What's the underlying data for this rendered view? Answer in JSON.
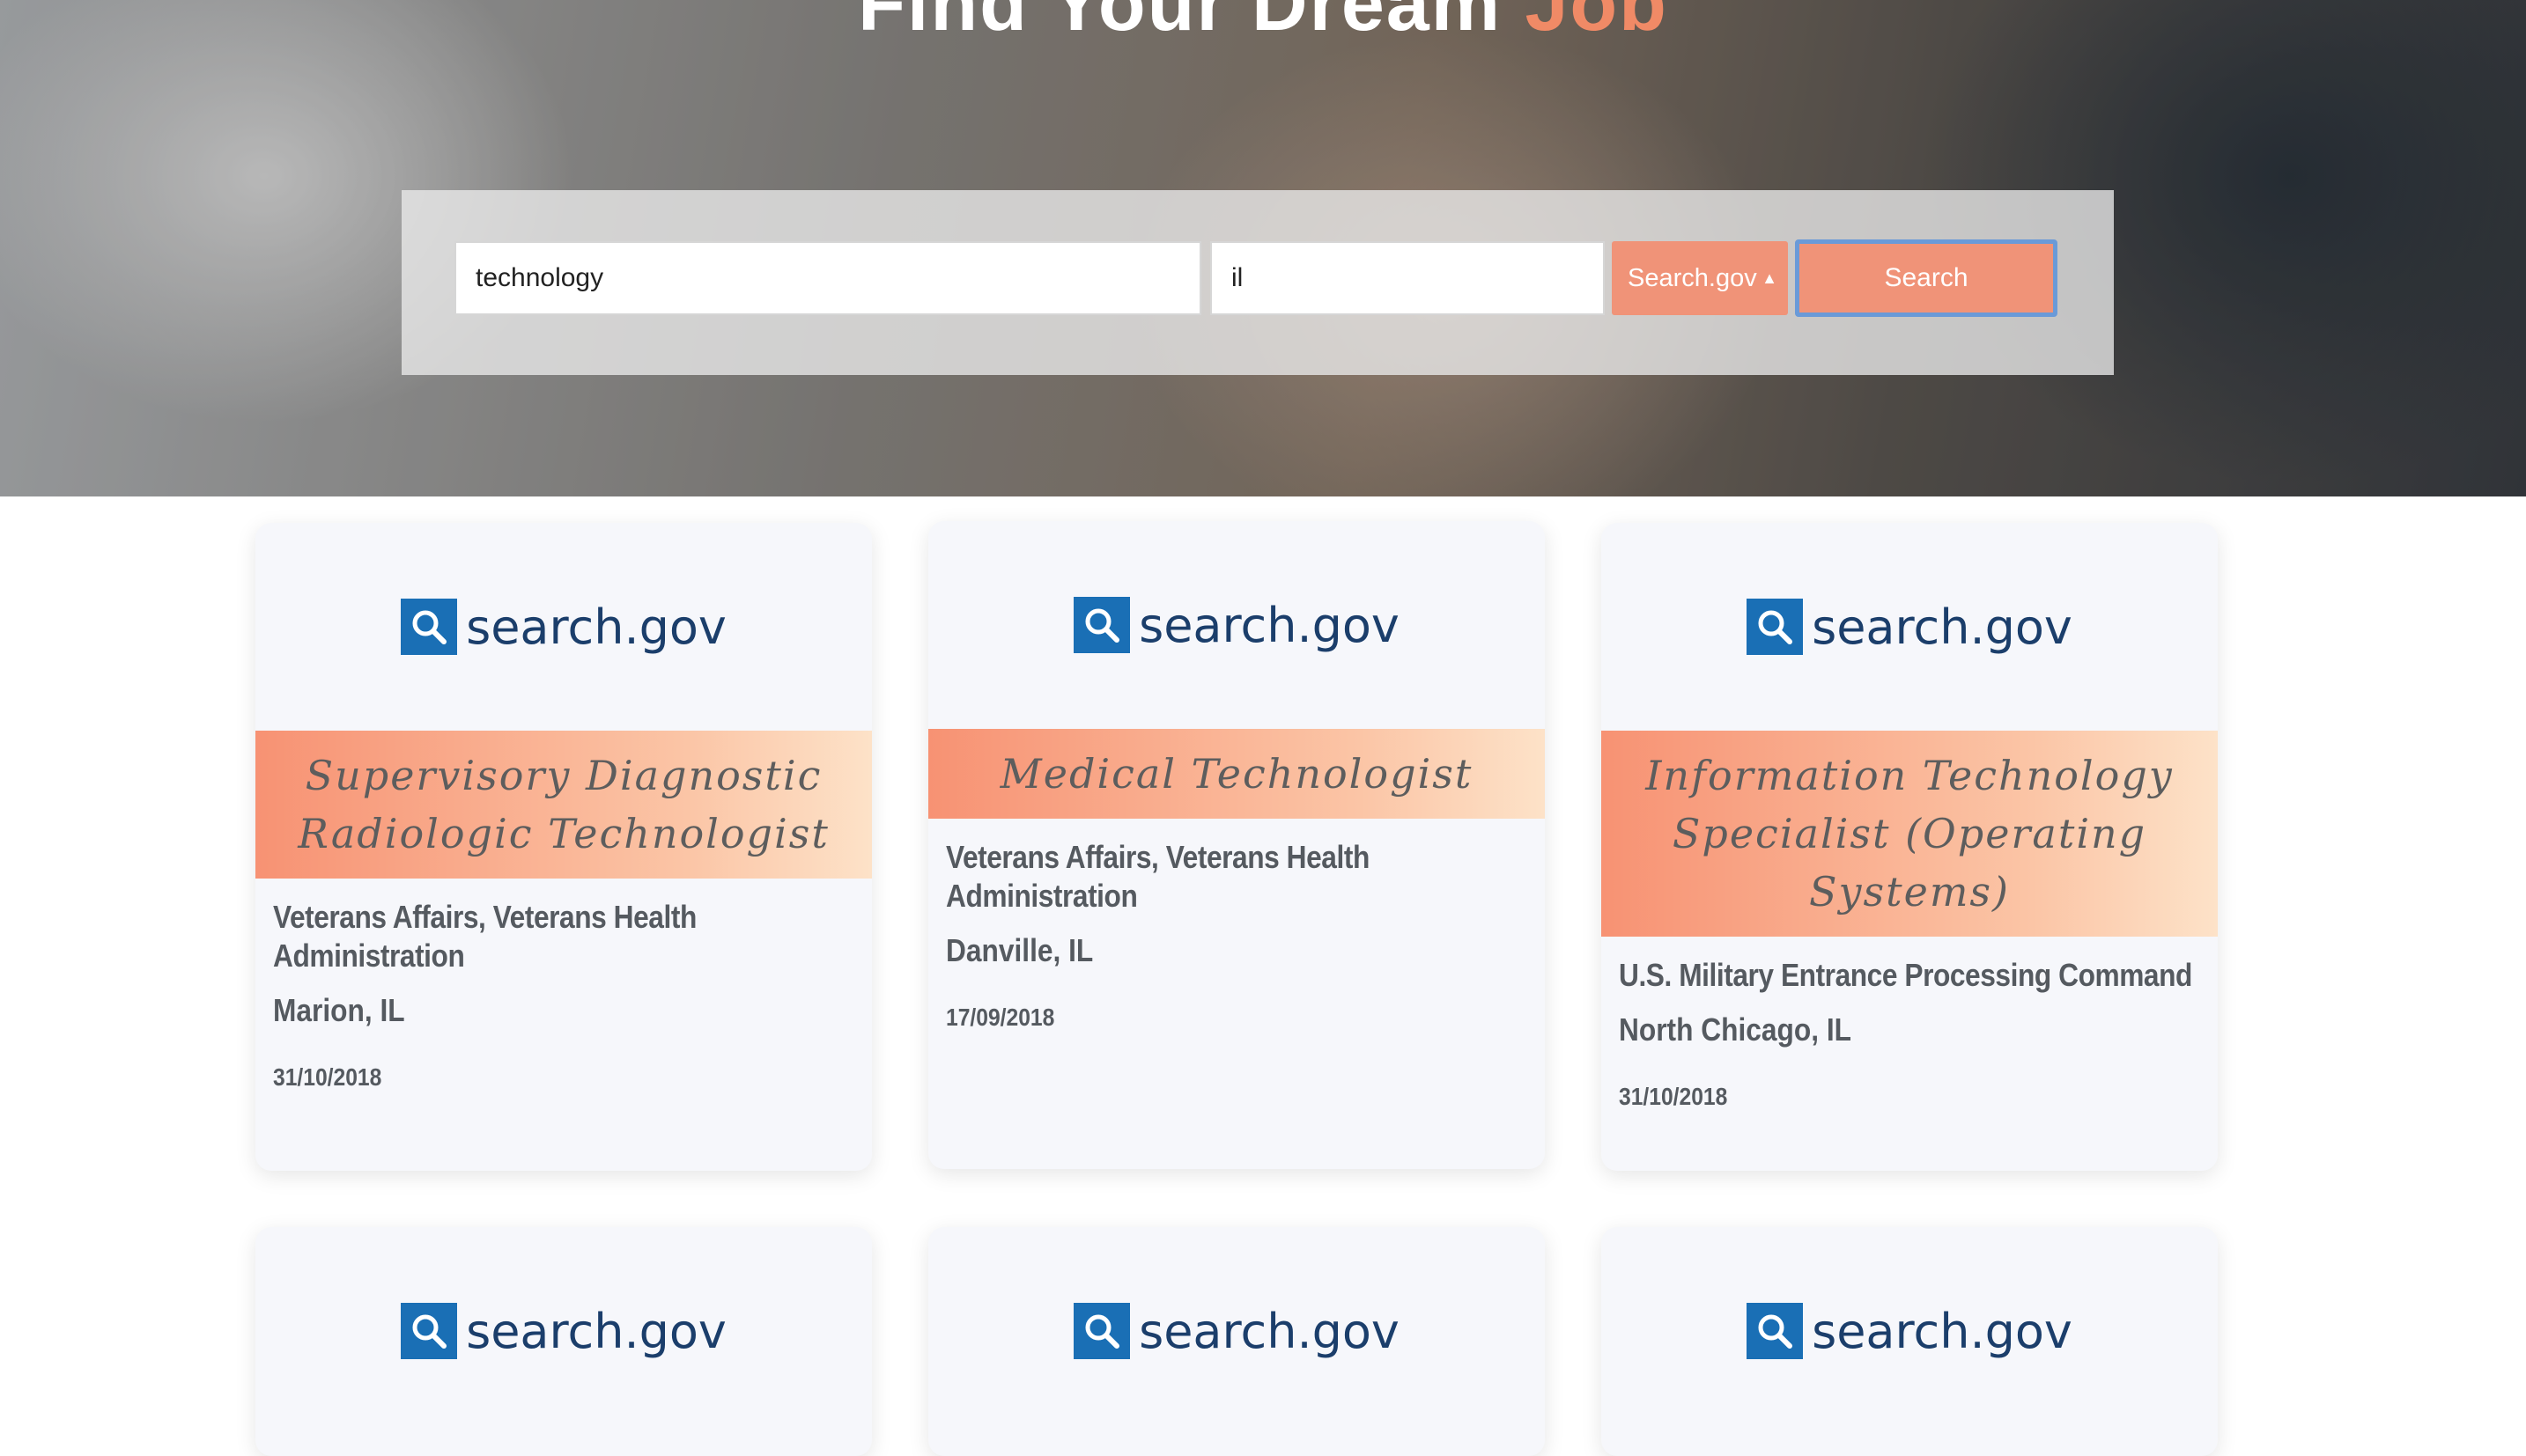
{
  "hero": {
    "title_main": "Find Your Dream",
    "title_accent": "Job"
  },
  "search": {
    "keyword_value": "technology",
    "location_value": "il",
    "source_label": "Search.gov",
    "button_label": "Search"
  },
  "brand": {
    "logo_text": "search.gov",
    "logo_color": "#1a6fb5",
    "accent_color": "#f09378"
  },
  "jobs": [
    {
      "title": "Supervisory Diagnostic Radiologic Technologist",
      "agency": "Veterans Affairs, Veterans Health Administration",
      "location": "Marion, IL",
      "date": "31/10/2018"
    },
    {
      "title": "Medical Technologist",
      "agency": "Veterans Affairs, Veterans Health Administration",
      "location": "Danville, IL",
      "date": "17/09/2018"
    },
    {
      "title": "Information Technology Specialist (Operating Systems)",
      "agency": "U.S. Military Entrance Processing Command",
      "location": "North Chicago, IL",
      "date": "31/10/2018"
    }
  ]
}
